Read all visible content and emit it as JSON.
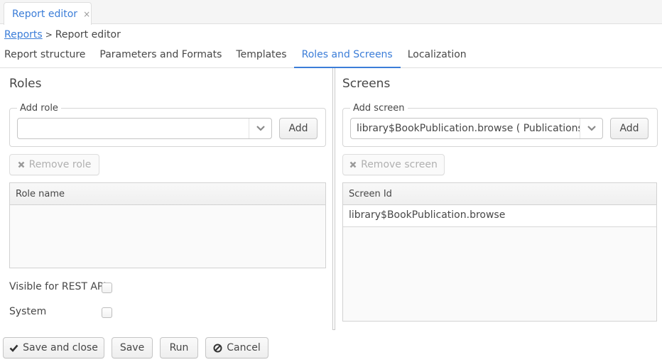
{
  "window_tab": {
    "title": "Report editor",
    "close_icon": "×"
  },
  "breadcrumb": {
    "parent": "Reports",
    "separator": ">",
    "current": "Report editor"
  },
  "tabs": [
    {
      "label": "Report structure",
      "active": false
    },
    {
      "label": "Parameters and Formats",
      "active": false
    },
    {
      "label": "Templates",
      "active": false
    },
    {
      "label": "Roles and Screens",
      "active": true
    },
    {
      "label": "Localization",
      "active": false
    }
  ],
  "roles": {
    "title": "Roles",
    "add_group_label": "Add role",
    "combo_value": "",
    "add_button": "Add",
    "remove_button": "Remove role",
    "table": {
      "columns": [
        "Role name"
      ],
      "rows": []
    },
    "visible_for_rest_label": "Visible for REST API",
    "visible_for_rest_checked": false,
    "system_label": "System",
    "system_checked": false
  },
  "screens": {
    "title": "Screens",
    "add_group_label": "Add screen",
    "combo_value": "library$BookPublication.browse ( Publications )",
    "add_button": "Add",
    "remove_button": "Remove screen",
    "table": {
      "columns": [
        "Screen Id"
      ],
      "rows": [
        "library$BookPublication.browse"
      ]
    }
  },
  "footer": {
    "save_and_close": "Save and close",
    "save": "Save",
    "run": "Run",
    "cancel": "Cancel"
  },
  "colors": {
    "accent": "#3b7dd8",
    "text": "#474747",
    "border": "#d2d2d2"
  }
}
